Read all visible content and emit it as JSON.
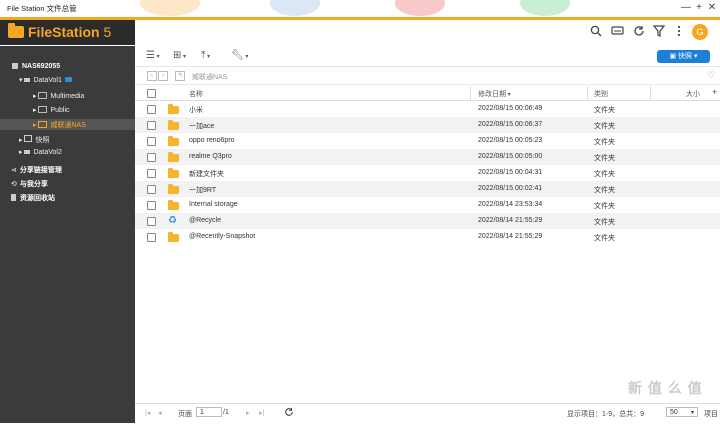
{
  "window": {
    "title": "File Station 文件总管",
    "minimize": "—",
    "maximize": "+",
    "close": "✕"
  },
  "header": {
    "brand_name": "FileStation",
    "brand_version": " 5",
    "avatar_letter": "G",
    "colors": {
      "accent": "#f5a623",
      "primary": "#1e7fd8"
    }
  },
  "sidebar": {
    "nas": "NAS692055",
    "datavol1": "DataVol1",
    "multimedia": "Multimedia",
    "public": "Public",
    "selected_folder": "威联通NAS",
    "snapshot": "快照",
    "datavol2": "DataVol2",
    "share_link": "分享链接管理",
    "shared_with_me": "与我分享",
    "recycle": "资源回收站"
  },
  "toolbar": {
    "snapshot_button": "快照"
  },
  "path": {
    "current": "威联通NAS"
  },
  "table": {
    "columns": {
      "name": "名称",
      "modified": "修改日期",
      "type": "类别",
      "size": "大小"
    },
    "rows": [
      {
        "name": "小米",
        "modified": "2022/08/15 00:06:49",
        "type": "文件夹",
        "icon": "folder-icon"
      },
      {
        "name": "一加ace",
        "modified": "2022/08/15 00:06:37",
        "type": "文件夹",
        "icon": "folder-icon"
      },
      {
        "name": "oppo reno6pro",
        "modified": "2022/08/15 00:05:23",
        "type": "文件夹",
        "icon": "folder-icon"
      },
      {
        "name": "realme Q3pro",
        "modified": "2022/08/15 00:05:00",
        "type": "文件夹",
        "icon": "folder-icon"
      },
      {
        "name": "新建文件夹",
        "modified": "2022/08/15 00:04:31",
        "type": "文件夹",
        "icon": "folder-icon"
      },
      {
        "name": "一加9RT",
        "modified": "2022/08/15 00:02:41",
        "type": "文件夹",
        "icon": "folder-icon"
      },
      {
        "name": "Internal storage",
        "modified": "2022/08/14 23:53:34",
        "type": "文件夹",
        "icon": "folder-icon"
      },
      {
        "name": "@Recycle",
        "modified": "2022/08/14 21:55:29",
        "type": "文件夹",
        "icon": "recycle-icon"
      },
      {
        "name": "@Recently-Snapshot",
        "modified": "2022/08/14 21:55:29",
        "type": "文件夹",
        "icon": "folder-icon"
      }
    ]
  },
  "footer": {
    "page_label": "页面",
    "page_value": "1",
    "page_total": "/1",
    "display_info": "显示项目：1-9，总共：9",
    "page_size": "50",
    "items_label": "项目"
  },
  "watermark": "新 值 么 值"
}
